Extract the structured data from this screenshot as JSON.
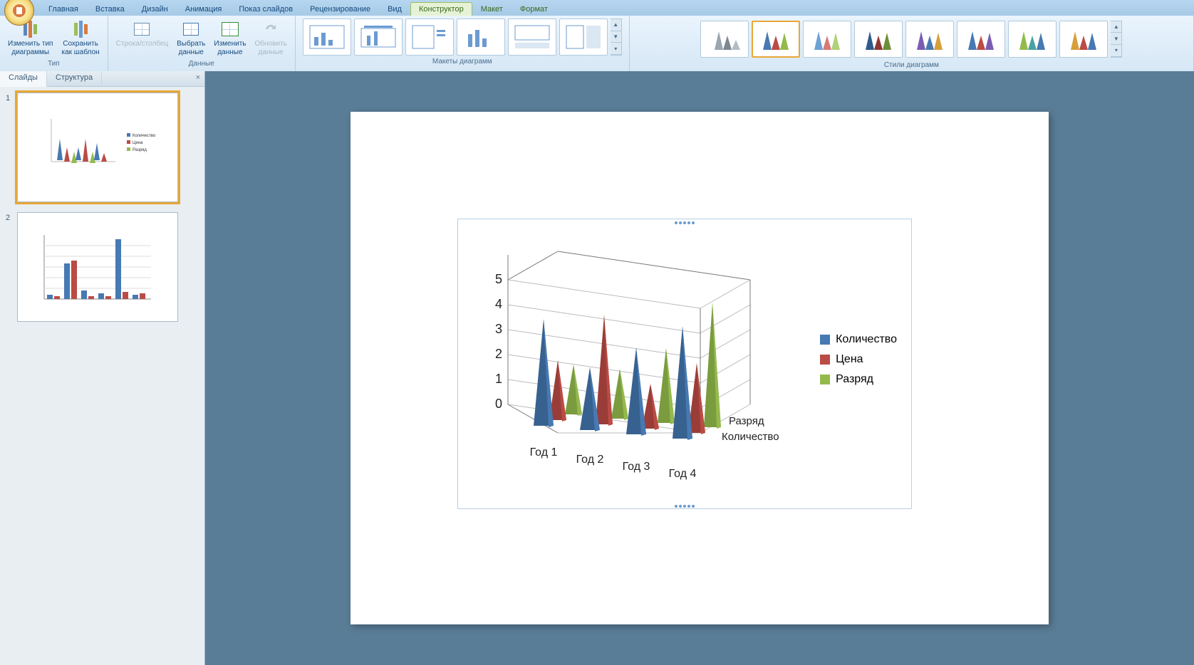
{
  "tabs": {
    "home": "Главная",
    "insert": "Вставка",
    "design": "Дизайн",
    "anim": "Анимация",
    "slideshow": "Показ слайдов",
    "review": "Рецензирование",
    "view": "Вид",
    "ctx_designer": "Конструктор",
    "ctx_layout": "Макет",
    "ctx_format": "Формат"
  },
  "ribbon": {
    "type_group": "Тип",
    "change_type": "Изменить тип\nдиаграммы",
    "save_template": "Сохранить\nкак шаблон",
    "data_group": "Данные",
    "row_col": "Строка/столбец",
    "select_data": "Выбрать\nданные",
    "edit_data": "Изменить\nданные",
    "refresh_data": "Обновить\nданные",
    "layouts_group": "Макеты диаграмм",
    "styles_group": "Стили диаграмм"
  },
  "leftpanel": {
    "slides_tab": "Слайды",
    "outline_tab": "Структура",
    "slide1_num": "1",
    "slide2_num": "2"
  },
  "chart_data": {
    "type": "bar",
    "note": "3D cone chart",
    "categories": [
      "Год 1",
      "Год 2",
      "Год 3",
      "Год 4"
    ],
    "depth_labels": [
      "Количество",
      "Разряд"
    ],
    "series": [
      {
        "name": "Количество",
        "color": "#4779b3",
        "values": [
          4.3,
          2.5,
          3.5,
          4.5
        ]
      },
      {
        "name": "Цена",
        "color": "#bb4b45",
        "values": [
          2.4,
          4.4,
          1.8,
          2.8
        ]
      },
      {
        "name": "Разряд",
        "color": "#94ba4c",
        "values": [
          2.0,
          2.0,
          3.0,
          5.0
        ]
      }
    ],
    "ylim": [
      0,
      5
    ],
    "yticks": [
      0,
      1,
      2,
      3,
      4,
      5
    ]
  },
  "legend": {
    "s1": "Количество",
    "s2": "Цена",
    "s3": "Разряд"
  },
  "colors": {
    "series1": "#4779b3",
    "series2": "#bb4b45",
    "series3": "#94ba4c"
  },
  "axis": {
    "y0": "0",
    "y1": "1",
    "y2": "2",
    "y3": "3",
    "y4": "4",
    "y5": "5",
    "x1": "Год\n1",
    "x2": "Год\n2",
    "x3": "Год\n3",
    "x4": "Год\n4",
    "z1": "Количество",
    "z2": "Разряд"
  }
}
